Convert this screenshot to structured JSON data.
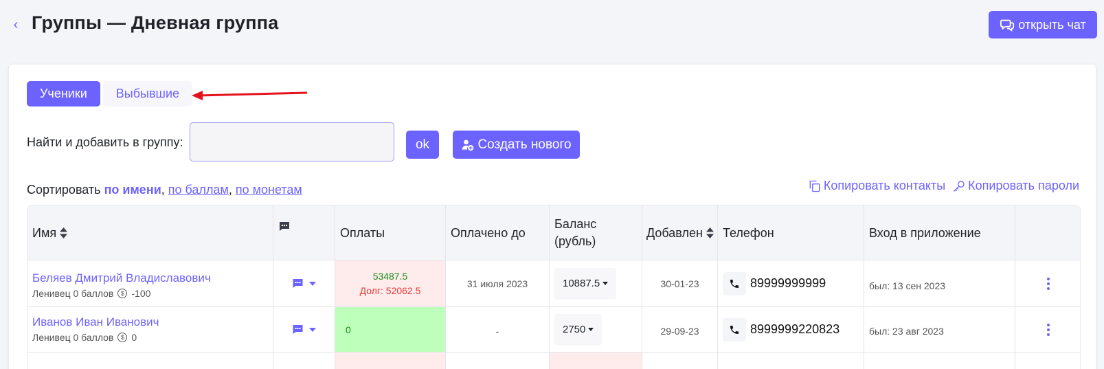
{
  "header": {
    "back_icon": "chevron-left-icon",
    "title": "Группы — Дневная группа",
    "chat_button": "открыть чат"
  },
  "tabs": [
    {
      "label": "Ученики",
      "active": true
    },
    {
      "label": "Выбывшие",
      "active": false
    }
  ],
  "search": {
    "label": "Найти и добавить в группу:",
    "value": "",
    "ok_button": "ok",
    "create_button": "Создать нового"
  },
  "sort": {
    "prefix": "Сортировать",
    "by_name": "по имени",
    "by_points": "по баллам",
    "by_coins": "по монетам"
  },
  "actions": {
    "copy_contacts": "Копировать контакты",
    "copy_passwords": "Копировать пароли"
  },
  "table": {
    "columns": {
      "name": "Имя",
      "payments": "Оплаты",
      "paid_until": "Оплачено до",
      "balance_line1": "Баланс",
      "balance_line2": "(рубль)",
      "added": "Добавлен",
      "phone": "Телефон",
      "app_login": "Вход в приложение"
    },
    "rows": [
      {
        "name": "Беляев Дмитрий Владиславович",
        "level": "Ленивец 0 баллов",
        "coins": "-100",
        "payment": "53487.5",
        "debt": "Долг: 52062.5",
        "payment_status": "debt",
        "paid_until": "31 июля 2023",
        "balance": "10887.5",
        "added": "30-01-23",
        "phone": "89999999999",
        "last_login": "был: 13 сен 2023"
      },
      {
        "name": "Иванов Иван Иванович",
        "level": "Ленивец 0 баллов",
        "coins": "0",
        "payment": "0",
        "debt": "",
        "payment_status": "ok",
        "paid_until": "-",
        "balance": "2750",
        "added": "29-09-23",
        "phone": "8999999220823",
        "last_login": "был: 23 авг 2023"
      }
    ]
  },
  "colors": {
    "accent": "#6c63ff",
    "debt_bg": "#fdeceb",
    "ok_bg": "#bfffbc",
    "debt_text": "#e23b3b",
    "amount_text": "#1a8d1a",
    "annotation_arrow": "#e3121c"
  }
}
